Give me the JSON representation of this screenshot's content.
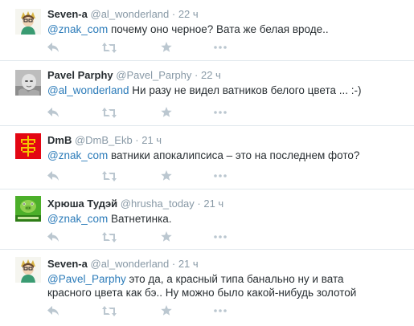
{
  "tweets": [
    {
      "fullname": "Seven-a",
      "username": "@al_wonderland",
      "time": " · 22 ч",
      "mention": "@znak_com",
      "text": " почему оно черное? Вата же белая вроде..",
      "avatar": "girl-avatar-icon"
    },
    {
      "fullname": "Pavel Parphy",
      "username": "@Pavel_Parphy",
      "time": " · 22 ч",
      "mention": "@al_wonderland",
      "text": "  Ни разу не видел ватников белого цвета ... :-)",
      "avatar": "baby-photo-avatar-icon"
    },
    {
      "fullname": "DmB",
      "username": "@DmB_Ekb",
      "time": " · 21 ч",
      "mention": "@znak_com",
      "text": " ватники апокалипсиса – это на последнем фото?",
      "avatar": "ornament-avatar-icon"
    },
    {
      "fullname": "Хрюша Тудэй",
      "username": "@hrusha_today",
      "time": " · 21 ч",
      "mention": "@znak_com",
      "text": " Ватнетинка.",
      "avatar": "green-pig-avatar-icon"
    },
    {
      "fullname": "Seven-a",
      "username": "@al_wonderland",
      "time": " · 21 ч",
      "mention": "@Pavel_Parphy",
      "text": " это да, а красный типа банально ну и вата красного цвета как бэ.. Ну можно было какой-нибудь золотой",
      "avatar": "girl-avatar-icon"
    }
  ],
  "actions": [
    "reply-icon",
    "retweet-icon",
    "favorite-icon",
    "more-icon"
  ],
  "colors": {
    "link": "#2b7bb9",
    "meta": "#8899a6",
    "icon": "#bbc7d0",
    "separator": "#e1e8ed"
  }
}
